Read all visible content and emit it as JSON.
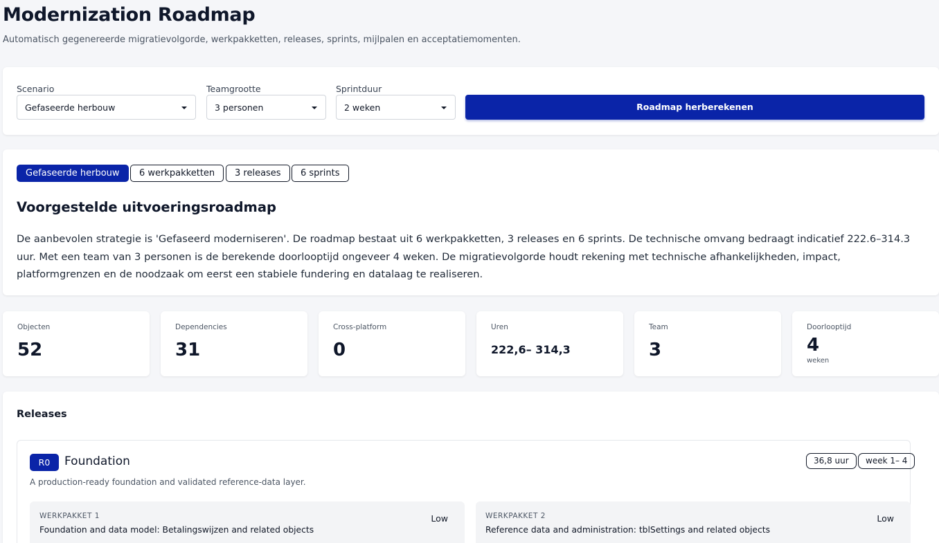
{
  "header": {
    "title": "Modernization Roadmap",
    "subtitle": "Automatisch gegenereerde migratievolgorde, werkpakketten, releases, sprints, mijlpalen en acceptatiemomenten."
  },
  "controls": {
    "scenario": {
      "label": "Scenario",
      "value": "Gefaseerde herbouw"
    },
    "team_size": {
      "label": "Teamgrootte",
      "value": "3 personen"
    },
    "sprint_duration": {
      "label": "Sprintduur",
      "value": "2 weken"
    },
    "recalc_label": "Roadmap herberekenen"
  },
  "summary": {
    "chips": [
      "Gefaseerde herbouw",
      "6 werkpakketten",
      "3 releases",
      "6 sprints"
    ],
    "title": "Voorgestelde uitvoeringsroadmap",
    "text": "De aanbevolen strategie is 'Gefaseerd moderniseren'. De roadmap bestaat uit 6 werkpakketten, 3 releases en 6 sprints. De technische omvang bedraagt indicatief 222.6–314.3 uur. Met een team van 3 personen is de berekende doorlooptijd ongeveer 4 weken. De migratievolgorde houdt rekening met technische afhankelijkheden, impact, platformgrenzen en de noodzaak om eerst een stabiele fundering en datalaag te realiseren."
  },
  "stats": [
    {
      "label": "Objecten",
      "value": "52"
    },
    {
      "label": "Dependencies",
      "value": "31"
    },
    {
      "label": "Cross-platform",
      "value": "0"
    },
    {
      "label": "Uren",
      "value": "222,6– 314,3"
    },
    {
      "label": "Team",
      "value": "3"
    },
    {
      "label": "Doorlooptijd",
      "value": "4",
      "unit": "weken"
    }
  ],
  "releases": {
    "title": "Releases",
    "items": [
      {
        "badge": "R0",
        "name": "Foundation",
        "description": "A production-ready foundation and validated reference-data layer.",
        "hours": "36,8 uur",
        "weeks": "week 1– 4",
        "work_packages": [
          {
            "label": "WERKPAKKET 1",
            "title": "Foundation and data model: Betalingswijzen and related objects",
            "risk": "Low"
          },
          {
            "label": "WERKPAKKET 2",
            "title": "Reference data and administration: tblSettings and related objects",
            "risk": "Low"
          }
        ]
      }
    ]
  },
  "colors": {
    "accent": "#0a24a8",
    "background": "#f5f6f9",
    "card": "#ffffff"
  }
}
